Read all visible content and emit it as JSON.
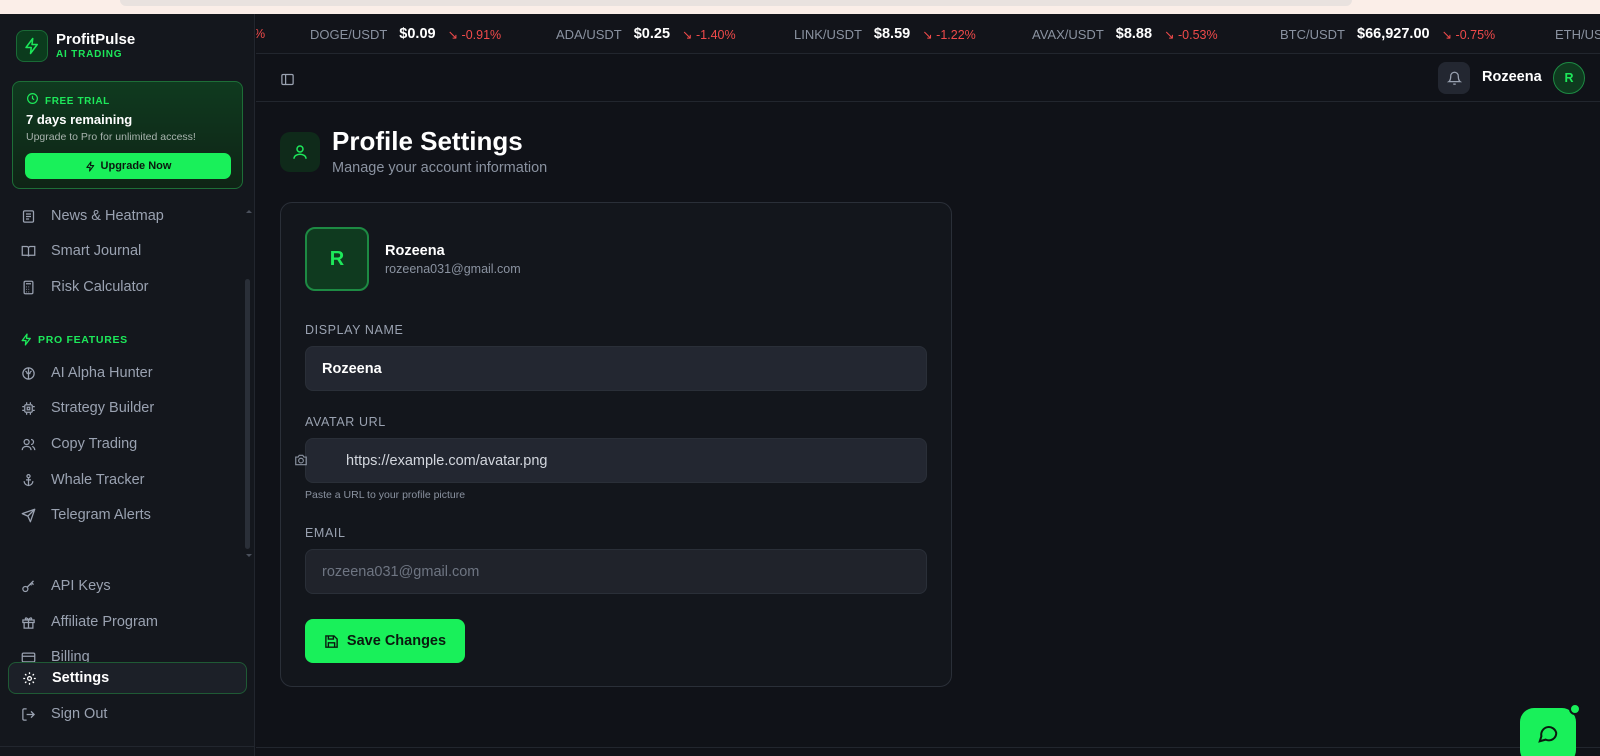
{
  "brand": {
    "name": "ProfitPulse",
    "sub": "AI TRADING"
  },
  "trial": {
    "tag": "FREE TRIAL",
    "days": "7 days remaining",
    "desc": "Upgrade to Pro for unlimited access!",
    "button": "Upgrade Now"
  },
  "nav": {
    "items": [
      {
        "label": "News & Heatmap",
        "icon": "newspaper-icon"
      },
      {
        "label": "Smart Journal",
        "icon": "book-open-icon"
      },
      {
        "label": "Risk Calculator",
        "icon": "calculator-icon"
      }
    ],
    "pro_label": "PRO FEATURES",
    "pro_items": [
      {
        "label": "AI Alpha Hunter",
        "icon": "brain-icon"
      },
      {
        "label": "Strategy Builder",
        "icon": "cpu-icon"
      },
      {
        "label": "Copy Trading",
        "icon": "users-icon"
      },
      {
        "label": "Whale Tracker",
        "icon": "anchor-icon"
      },
      {
        "label": "Telegram Alerts",
        "icon": "send-icon"
      }
    ],
    "account_items": [
      {
        "label": "API Keys",
        "icon": "key-icon"
      },
      {
        "label": "Affiliate Program",
        "icon": "gift-icon"
      },
      {
        "label": "Billing",
        "icon": "credit-card-icon"
      },
      {
        "label": "Settings",
        "icon": "gear-icon",
        "active": true
      },
      {
        "label": "Sign Out",
        "icon": "log-out-icon"
      }
    ]
  },
  "ticker": [
    {
      "sym": "",
      "price": "",
      "change": "%"
    },
    {
      "sym": "DOGE/USDT",
      "price": "$0.09",
      "change": "-0.91%"
    },
    {
      "sym": "ADA/USDT",
      "price": "$0.25",
      "change": "-1.40%"
    },
    {
      "sym": "LINK/USDT",
      "price": "$8.59",
      "change": "-1.22%"
    },
    {
      "sym": "AVAX/USDT",
      "price": "$8.88",
      "change": "-0.53%"
    },
    {
      "sym": "BTC/USDT",
      "price": "$66,927.00",
      "change": "-0.75%"
    },
    {
      "sym": "ETH/USDT",
      "price": "",
      "change": ""
    }
  ],
  "header": {
    "user": "Rozeena",
    "avatar_letter": "R"
  },
  "page": {
    "title": "Profile Settings",
    "subtitle": "Manage your account information"
  },
  "profile": {
    "avatar_letter": "R",
    "name": "Rozeena",
    "email": "rozeena031@gmail.com",
    "display_name_label": "DISPLAY NAME",
    "display_name_value": "Rozeena",
    "avatar_url_label": "AVATAR URL",
    "avatar_url_value": "https://example.com/avatar.png",
    "avatar_url_help": "Paste a URL to your profile picture",
    "email_label": "EMAIL",
    "email_value": "rozeena031@gmail.com",
    "save_label": "Save Changes"
  },
  "colors": {
    "accent": "#19f05a",
    "negative": "#f04a4a",
    "background": "#101218"
  }
}
